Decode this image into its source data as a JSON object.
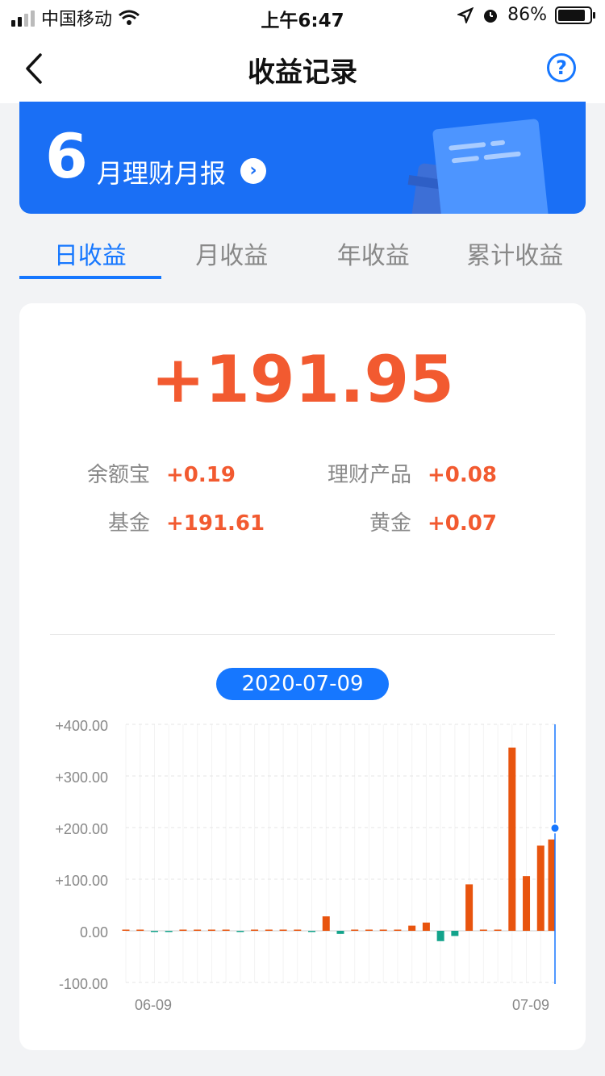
{
  "status_bar": {
    "carrier": "中国移动",
    "time": "上午6:47",
    "battery": "86%",
    "battery_level": 0.86
  },
  "nav": {
    "title": "收益记录"
  },
  "banner": {
    "number": "6",
    "text": "月理财月报"
  },
  "tabs": [
    {
      "label": "日收益",
      "active": true
    },
    {
      "label": "月收益",
      "active": false
    },
    {
      "label": "年收益",
      "active": false
    },
    {
      "label": "累计收益",
      "active": false
    }
  ],
  "summary": {
    "total": "+191.95",
    "items": [
      {
        "label": "余额宝",
        "value": "+0.19"
      },
      {
        "label": "理财产品",
        "value": "+0.08"
      },
      {
        "label": "基金",
        "value": "+191.61"
      },
      {
        "label": "黄金",
        "value": "+0.07"
      }
    ]
  },
  "chart": {
    "selected_date": "2020-07-09"
  },
  "colors": {
    "accent": "#1677ff",
    "gain": "#e8540e",
    "loss": "#13a38b",
    "total_text": "#f25a30"
  },
  "chart_data": {
    "type": "bar",
    "ylim": [
      -100,
      400
    ],
    "yticks": [
      "+400.00",
      "+300.00",
      "+200.00",
      "+100.00",
      "0.00",
      "-100.00"
    ],
    "ytick_values": [
      400,
      300,
      200,
      100,
      0,
      -100
    ],
    "xticks": [
      "06-09",
      "07-09"
    ],
    "selected_index": 30,
    "values": [
      0,
      0,
      -1,
      -1,
      0,
      0,
      0,
      1,
      -2,
      0,
      2,
      0,
      0,
      -1,
      28,
      -6,
      0,
      0,
      0,
      0,
      10,
      16,
      -20,
      -10,
      90,
      0,
      0,
      355,
      106,
      165,
      177
    ]
  }
}
